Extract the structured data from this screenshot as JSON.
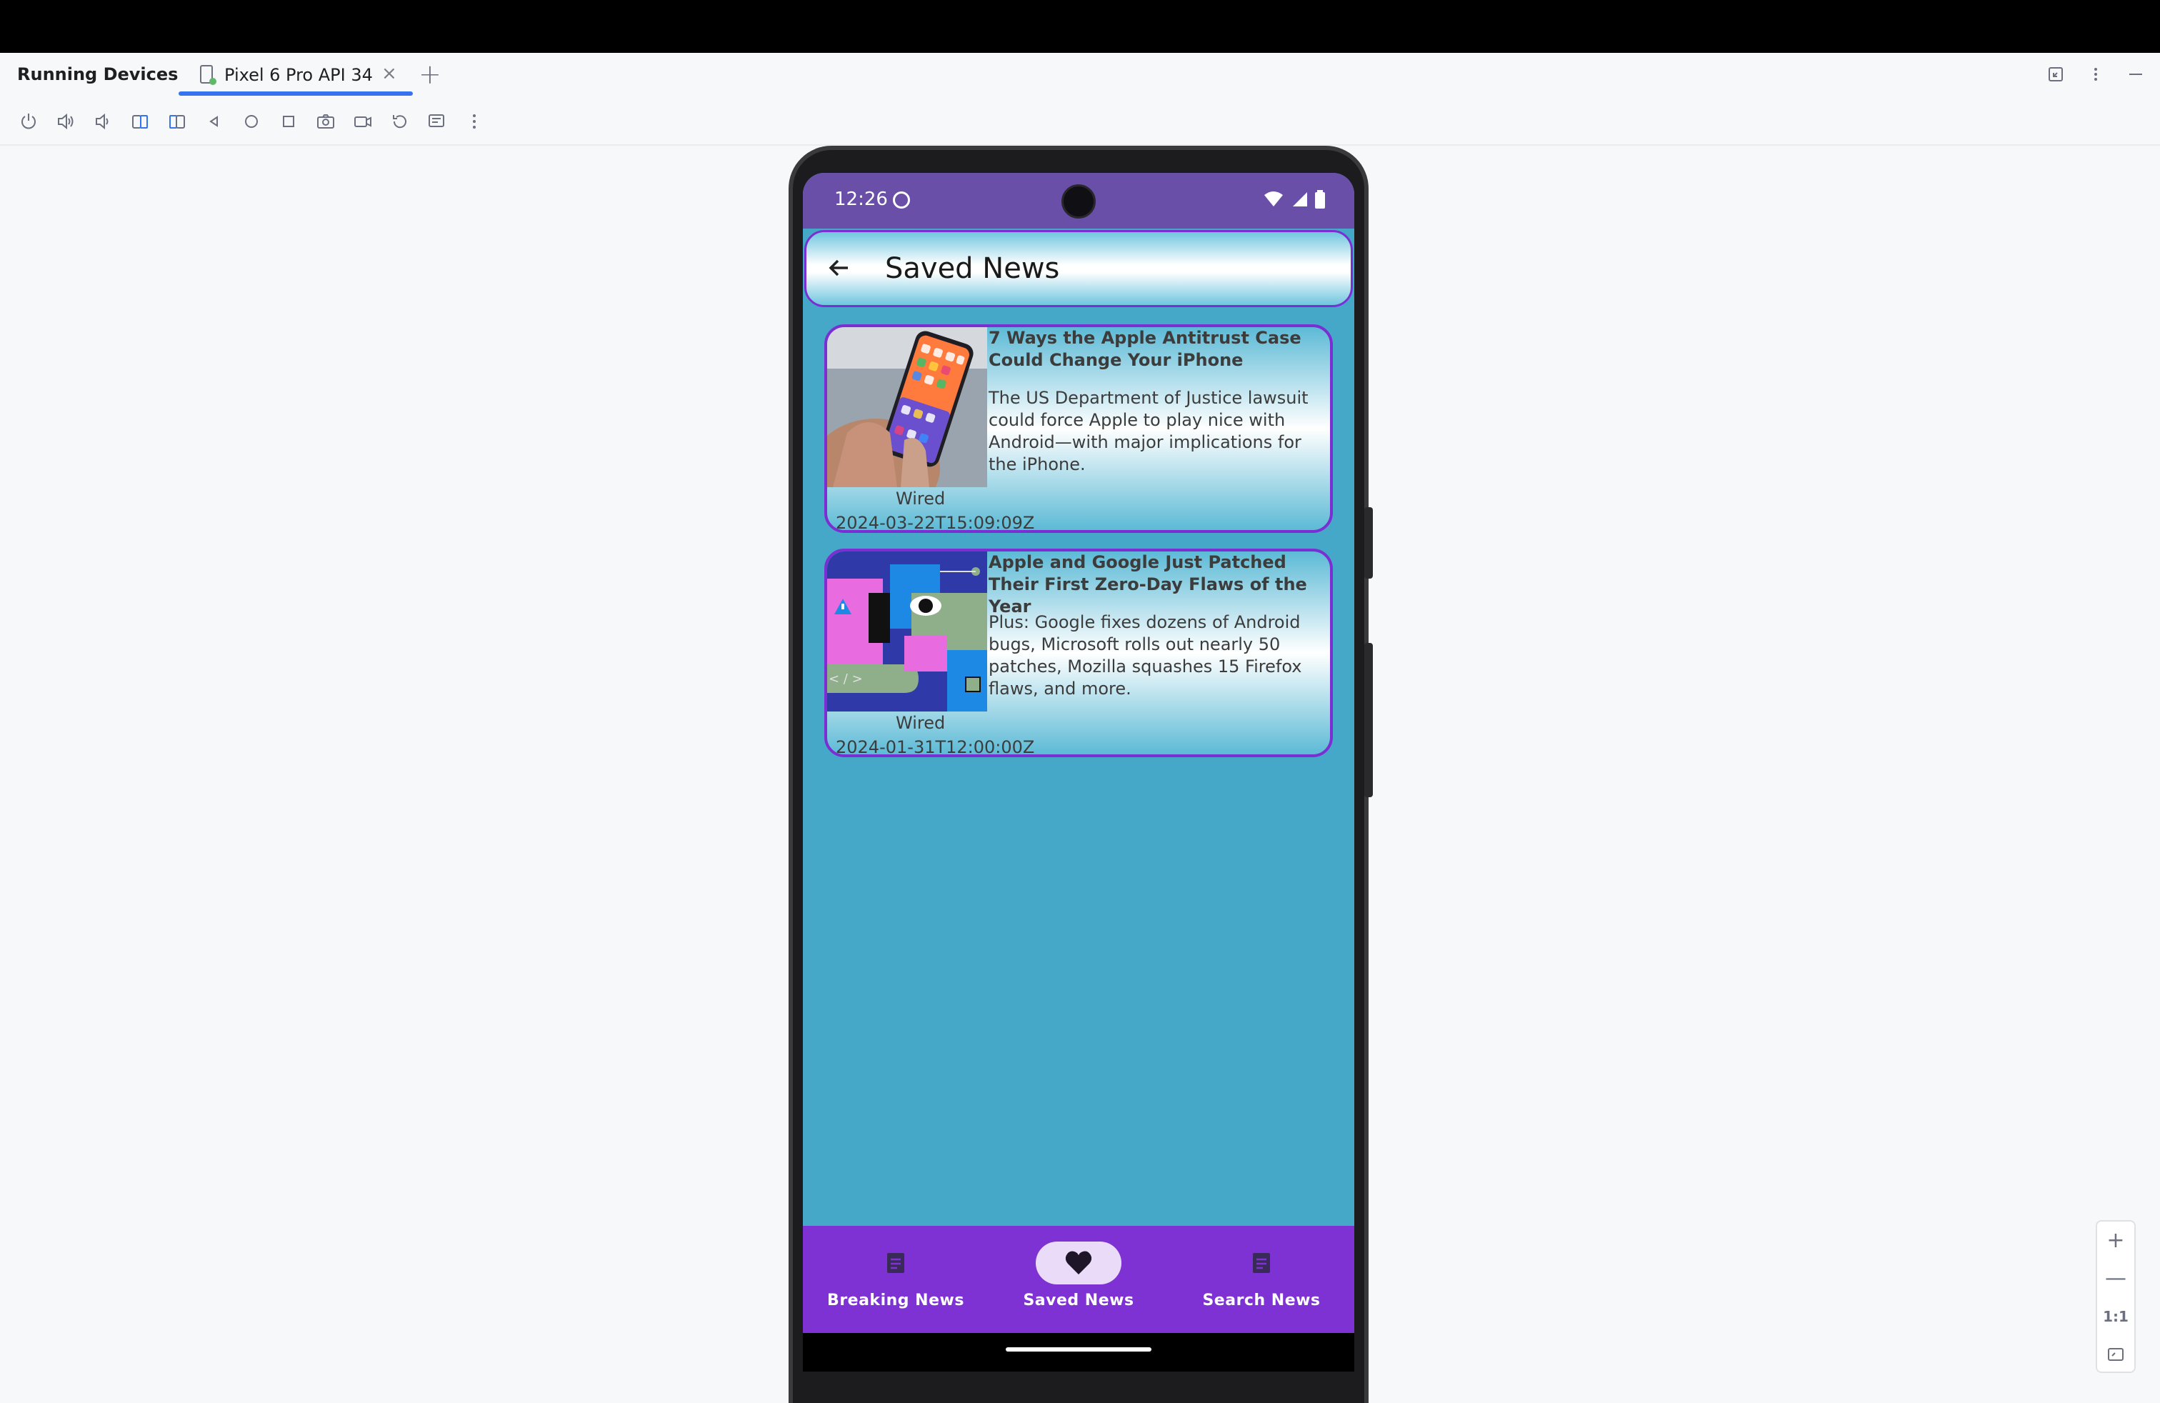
{
  "ide": {
    "panel_title": "Running Devices",
    "device_tab": "Pixel 6 Pro API 34",
    "add_tab": "+",
    "zoom": {
      "in": "+",
      "out": "—",
      "actual": "1:1"
    }
  },
  "phone": {
    "status": {
      "time": "12:26"
    },
    "appbar": {
      "title": "Saved News"
    },
    "articles": [
      {
        "title": "7 Ways the Apple Antitrust Case Could Change Your iPhone",
        "description": "The US Department of Justice lawsuit could force Apple to play nice with Android—with major implications for the iPhone.",
        "source": "Wired",
        "published": "2024-03-22T15:09:09Z"
      },
      {
        "title": "Apple and Google Just Patched Their First Zero-Day Flaws of the Year",
        "description": "Plus: Google fixes dozens of Android bugs, Microsoft rolls out nearly 50 patches, Mozilla squashes 15 Firefox flaws, and more.",
        "source": "Wired",
        "published": "2024-01-31T12:00:00Z"
      }
    ],
    "nav": [
      {
        "label": "Breaking News",
        "icon": "article-icon",
        "active": false
      },
      {
        "label": "Saved News",
        "icon": "heart-icon",
        "active": true
      },
      {
        "label": "Search News",
        "icon": "article-icon",
        "active": false
      }
    ]
  },
  "colors": {
    "accent": "#7e32d4",
    "status_bar": "#6a4fa8",
    "screen_bg": "#45a8c9",
    "tab_underline": "#3574f0"
  }
}
